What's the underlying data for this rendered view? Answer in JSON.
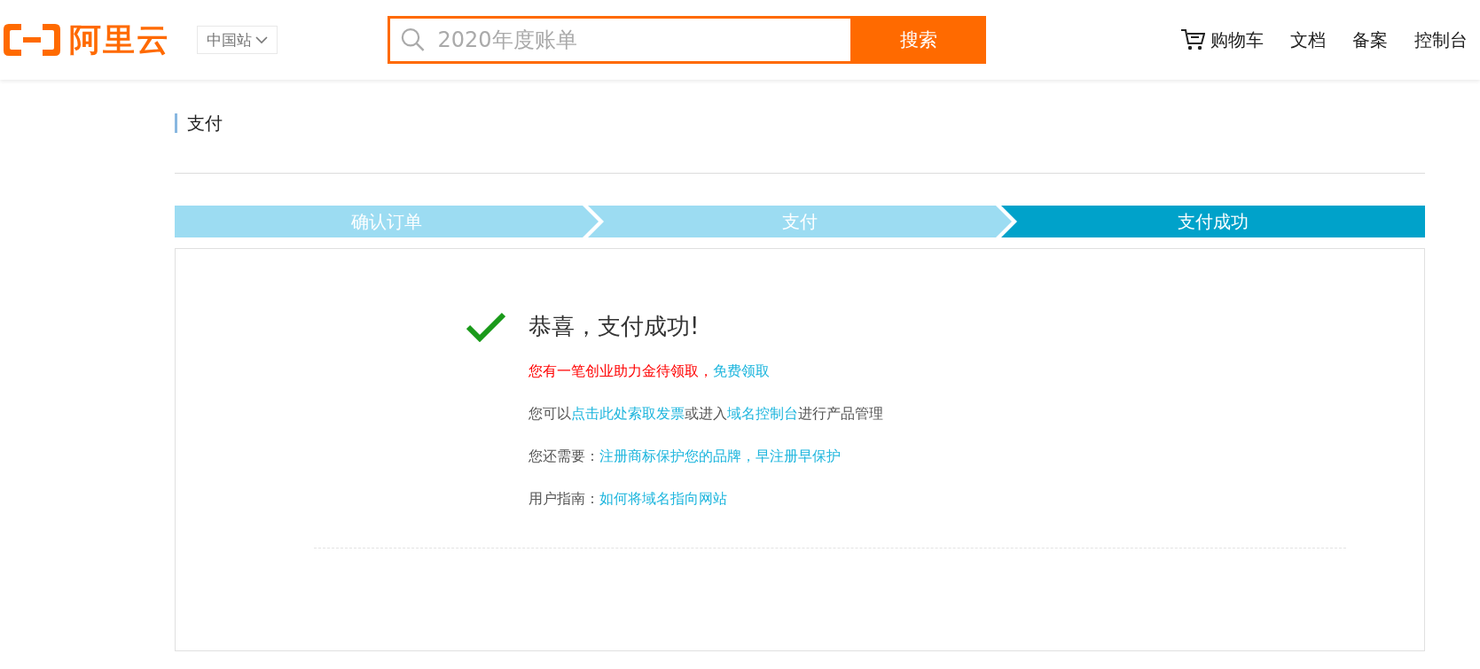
{
  "header": {
    "logo": "阿里云",
    "site_selector": "中国站",
    "search": {
      "placeholder": "2020年度账单",
      "button": "搜索"
    },
    "nav": [
      {
        "label": "购物车",
        "kind": "cart"
      },
      {
        "label": "文档",
        "kind": "plain"
      },
      {
        "label": "备案",
        "kind": "plain"
      },
      {
        "label": "控制台",
        "kind": "plain"
      }
    ]
  },
  "page_title": "支付",
  "steps": [
    {
      "label": "确认订单",
      "selected": false
    },
    {
      "label": "支付",
      "selected": false
    },
    {
      "label": "支付成功",
      "selected": true
    }
  ],
  "result": {
    "title": "恭喜，支付成功!",
    "lines": [
      {
        "segments": [
          {
            "kind": "alert",
            "text": "您有一笔创业助力金待领取，"
          },
          {
            "kind": "link",
            "text": "免费领取"
          }
        ]
      },
      {
        "segments": [
          {
            "kind": "text",
            "text": "您可以"
          },
          {
            "kind": "link",
            "text": "点击此处索取发票"
          },
          {
            "kind": "text",
            "text": "或进入"
          },
          {
            "kind": "link",
            "text": "域名控制台"
          },
          {
            "kind": "text",
            "text": "进行产品管理"
          }
        ]
      },
      {
        "segments": [
          {
            "kind": "text",
            "text": "您还需要："
          },
          {
            "kind": "link",
            "text": "注册商标保护您的品牌，早注册早保护"
          }
        ]
      },
      {
        "segments": [
          {
            "kind": "text",
            "text": "用户指南："
          },
          {
            "kind": "link",
            "text": "如何将域名指向网站"
          }
        ]
      }
    ]
  }
}
